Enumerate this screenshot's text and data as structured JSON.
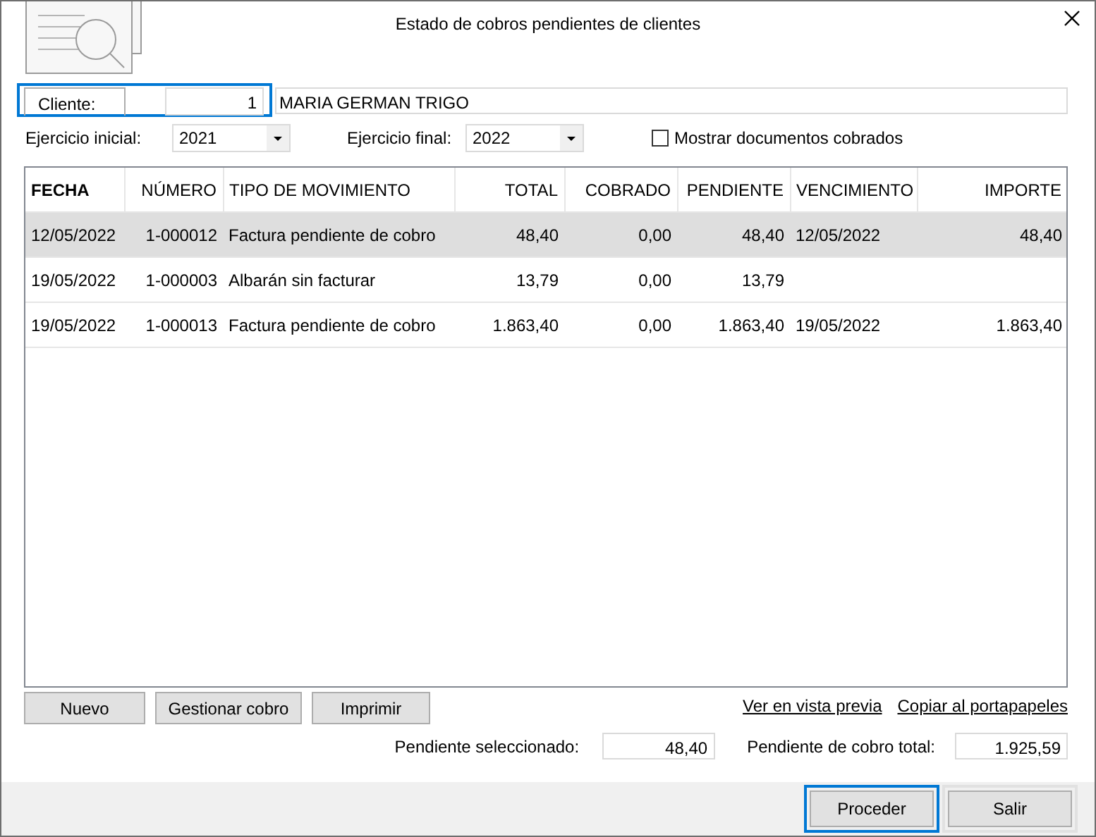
{
  "window": {
    "title": "Estado de cobros pendientes de clientes"
  },
  "cliente": {
    "label": "Cliente:",
    "code": "1",
    "name": "MARIA GERMAN TRIGO",
    "focused": true
  },
  "ejercicio_inicial": {
    "label": "Ejercicio inicial:",
    "value": "2021"
  },
  "ejercicio_final": {
    "label": "Ejercicio final:",
    "value": "2022"
  },
  "mostrar_cobrados": {
    "label": "Mostrar documentos cobrados",
    "checked": false
  },
  "table": {
    "columns": [
      "FECHA",
      "NÚMERO",
      "TIPO DE MOVIMIENTO",
      "TOTAL",
      "COBRADO",
      "PENDIENTE",
      "VENCIMIENTO",
      "IMPORTE"
    ],
    "rows": [
      {
        "selected": true,
        "cells": [
          "12/05/2022",
          "1-000012",
          "Factura pendiente de cobro",
          "48,40",
          "0,00",
          "48,40",
          "12/05/2022",
          "48,40"
        ]
      },
      {
        "selected": false,
        "cells": [
          "19/05/2022",
          "1-000003",
          "Albarán sin facturar",
          "13,79",
          "0,00",
          "13,79",
          "",
          ""
        ]
      },
      {
        "selected": false,
        "cells": [
          "19/05/2022",
          "1-000013",
          "Factura pendiente de cobro",
          "1.863,40",
          "0,00",
          "1.863,40",
          "19/05/2022",
          "1.863,40"
        ]
      }
    ]
  },
  "actions": [
    "Nuevo",
    "Gestionar cobro",
    "Imprimir"
  ],
  "links": [
    "Ver en vista previa",
    "Copiar al portapapeles"
  ],
  "totals": [
    {
      "label": "Pendiente seleccionado:",
      "value": "48,40"
    },
    {
      "label": "Pendiente de cobro total:",
      "value": "1.925,59"
    }
  ],
  "footer_buttons": [
    {
      "label": "Proceder",
      "focused": true
    },
    {
      "label": "Salir",
      "focused": false
    }
  ]
}
